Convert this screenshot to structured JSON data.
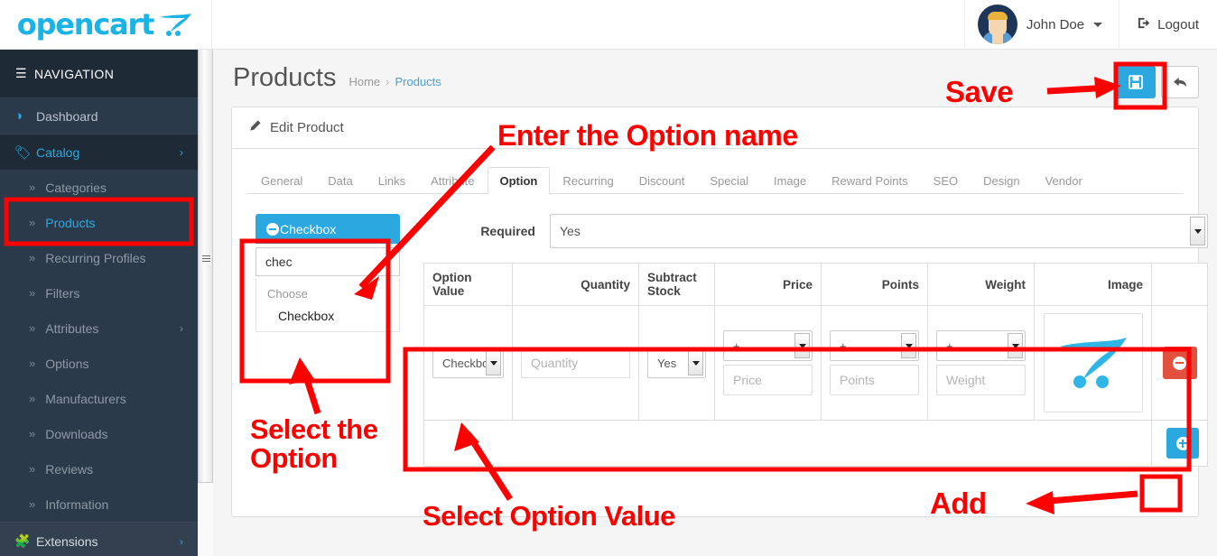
{
  "brand": {
    "name": "opencart",
    "logo_icon": "shopping-cart-icon"
  },
  "header": {
    "user_name": "John Doe",
    "logout_label": "Logout",
    "avatar_icon": "user-avatar",
    "caret_icon": "chevron-down-icon",
    "logout_icon": "logout-icon"
  },
  "sidebar": {
    "nav_label": "NAVIGATION",
    "menu_icon": "hamburger-icon",
    "items": [
      {
        "label": "Dashboard",
        "icon": "dashboard-icon",
        "type": "parent",
        "has_chevron": false
      },
      {
        "label": "Catalog",
        "icon": "tag-icon",
        "type": "parent-active",
        "has_chevron": true
      },
      {
        "label": "Categories",
        "icon": "angle-double-right-icon",
        "type": "sub",
        "has_chevron": false
      },
      {
        "label": "Products",
        "icon": "angle-double-right-icon",
        "type": "sub-highlight",
        "has_chevron": false
      },
      {
        "label": "Recurring Profiles",
        "icon": "angle-double-right-icon",
        "type": "sub",
        "has_chevron": false
      },
      {
        "label": "Filters",
        "icon": "angle-double-right-icon",
        "type": "sub",
        "has_chevron": false
      },
      {
        "label": "Attributes",
        "icon": "angle-double-right-icon",
        "type": "sub",
        "has_chevron": true
      },
      {
        "label": "Options",
        "icon": "angle-double-right-icon",
        "type": "sub",
        "has_chevron": false
      },
      {
        "label": "Manufacturers",
        "icon": "angle-double-right-icon",
        "type": "sub",
        "has_chevron": false
      },
      {
        "label": "Downloads",
        "icon": "angle-double-right-icon",
        "type": "sub",
        "has_chevron": false
      },
      {
        "label": "Reviews",
        "icon": "angle-double-right-icon",
        "type": "sub",
        "has_chevron": false
      },
      {
        "label": "Information",
        "icon": "angle-double-right-icon",
        "type": "sub",
        "has_chevron": false
      },
      {
        "label": "Extensions",
        "icon": "puzzle-icon",
        "type": "ext",
        "has_chevron": true
      }
    ]
  },
  "page": {
    "title": "Products",
    "breadcrumb": {
      "home": "Home",
      "separator": "›",
      "current": "Products"
    },
    "save_icon": "floppy-save-icon",
    "back_icon": "reply-arrow-icon"
  },
  "panel": {
    "heading": "Edit Product",
    "heading_icon": "pencil-icon"
  },
  "tabs": [
    {
      "label": "General",
      "active": false
    },
    {
      "label": "Data",
      "active": false
    },
    {
      "label": "Links",
      "active": false
    },
    {
      "label": "Attribute",
      "active": false
    },
    {
      "label": "Option",
      "active": true
    },
    {
      "label": "Recurring",
      "active": false
    },
    {
      "label": "Discount",
      "active": false
    },
    {
      "label": "Special",
      "active": false
    },
    {
      "label": "Image",
      "active": false
    },
    {
      "label": "Reward Points",
      "active": false
    },
    {
      "label": "SEO",
      "active": false
    },
    {
      "label": "Design",
      "active": false
    },
    {
      "label": "Vendor",
      "active": false
    }
  ],
  "option_list": {
    "selected_option": "Checkbox",
    "remove_icon": "minus-circle-icon",
    "search_value": "chec",
    "dropdown_group_label": "Choose",
    "dropdown_items": [
      "Checkbox"
    ]
  },
  "option_form": {
    "required_label": "Required",
    "required_value": "Yes",
    "table": {
      "headers": [
        "Option Value",
        "Quantity",
        "Subtract Stock",
        "Price",
        "Points",
        "Weight",
        "Image",
        ""
      ],
      "row": {
        "option_value": "Checkbox",
        "quantity_placeholder": "Quantity",
        "subtract_stock": "Yes",
        "price_prefix": "+",
        "price_placeholder": "Price",
        "points_prefix": "+",
        "points_placeholder": "Points",
        "weight_prefix": "+",
        "weight_placeholder": "Weight",
        "image_icon": "opencart-cart-placeholder",
        "remove_icon": "minus-circle-icon"
      },
      "add_icon": "plus-circle-icon"
    }
  },
  "annotations": [
    {
      "id": "enter-option-name",
      "text": "Enter the Option name"
    },
    {
      "id": "save",
      "text": "Save"
    },
    {
      "id": "select-the-option",
      "text": "Select the\nOption"
    },
    {
      "id": "select-option-value",
      "text": "Select Option Value"
    },
    {
      "id": "add",
      "text": "Add"
    }
  ],
  "colors": {
    "brand_blue": "#1ab3e8",
    "accent_blue": "#2ca8e0",
    "sidebar_bg": "#2b3a4a",
    "annotation_red": "#fc0000",
    "danger_red": "#e0523e"
  }
}
